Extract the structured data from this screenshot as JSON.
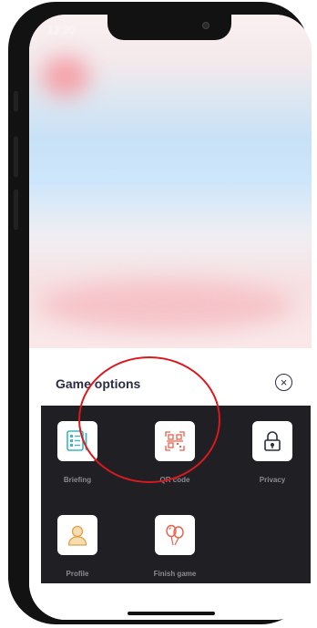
{
  "status_bar": {
    "time": "12:20"
  },
  "sheet": {
    "title": "Game options",
    "close_label": "×"
  },
  "options": [
    {
      "label": "Briefing",
      "icon": "clipboard-icon"
    },
    {
      "label": "QR code",
      "icon": "qr-code-icon"
    },
    {
      "label": "Privacy",
      "icon": "lock-icon"
    },
    {
      "label": "Profile",
      "icon": "user-icon"
    },
    {
      "label": "Finish game",
      "icon": "balloons-icon"
    }
  ],
  "colors": {
    "accent": "#e8604c",
    "teal": "#3ab7c2",
    "annotation": "#d9191e"
  }
}
